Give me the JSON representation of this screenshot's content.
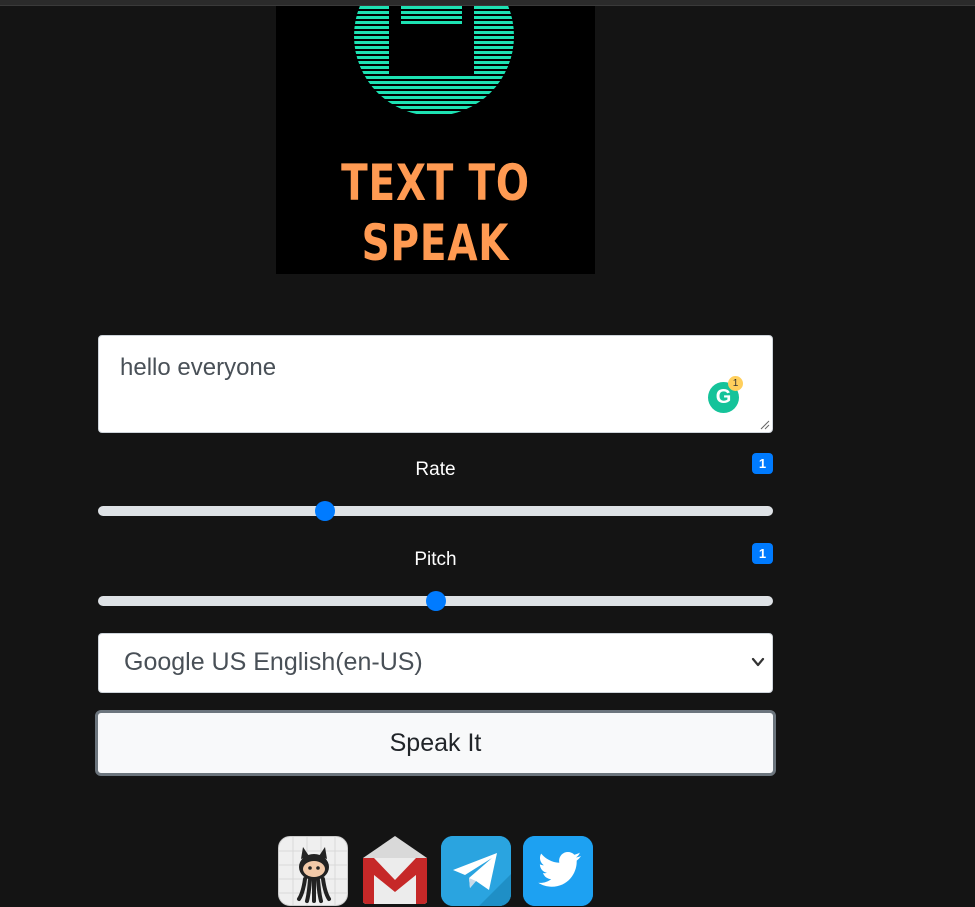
{
  "logo": {
    "line1": "TEXT TO",
    "line2": "SPEAK"
  },
  "textarea": {
    "value": "hello everyone",
    "grammarly_count": "1"
  },
  "rate": {
    "label": "Rate",
    "value": "1",
    "fraction": 0.336
  },
  "pitch": {
    "label": "Pitch",
    "value": "1",
    "fraction": 0.5
  },
  "voice_select": {
    "selected": "Google US English(en-US)"
  },
  "speak_button": {
    "label": "Speak It"
  },
  "social": {
    "icons": [
      "github-icon",
      "gmail-icon",
      "telegram-icon",
      "twitter-icon"
    ]
  },
  "colors": {
    "background": "#141414",
    "accent": "#007bff",
    "logo_text": "#ff9a52",
    "logo_stripes": "#1de2b3"
  }
}
